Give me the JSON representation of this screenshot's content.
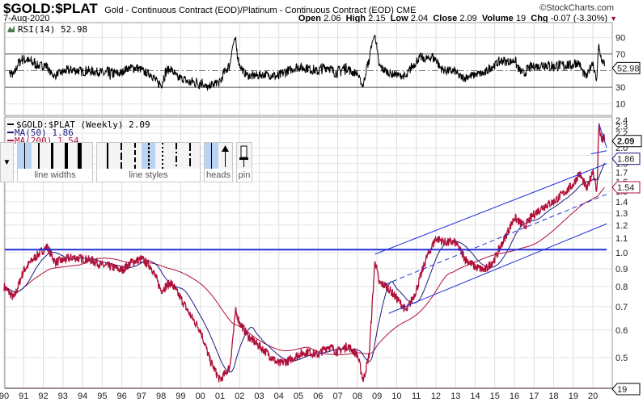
{
  "header": {
    "symbol": "$GOLD:$PLAT",
    "subtitle": "Gold - Continuous Contract (EOD)/Platinum - Continuous Contract (EOD)  CME",
    "logo": "©StockCharts.com",
    "date": "7-Aug-2020",
    "open_label": "Open",
    "open": "2.06",
    "high_label": "High",
    "high": "2.15",
    "low_label": "Low",
    "low": "2.04",
    "close_label": "Close",
    "close": "2.09",
    "volume_label": "Volume",
    "volume": "19",
    "chg_label": "Chg",
    "chg": "-0.07 (-3.30%)"
  },
  "toolbar": {
    "widths_label": "line widths",
    "styles_label": "line styles",
    "heads_label": "heads",
    "pin_label": "pin"
  },
  "colors": {
    "price": "#b0103a",
    "ma50": "#1a1a80",
    "ma200": "#b0103a",
    "trend": "#1f2fd8",
    "rsi": "#000000"
  },
  "chart_data": [
    {
      "type": "line",
      "title": "RSI(14) 52.98",
      "legend": "RSI(14) 52.98",
      "last_value_tag": "52.98",
      "yticks": [
        "90",
        "70",
        "30",
        "10"
      ],
      "ylim": [
        0,
        100
      ],
      "overbought": 70,
      "oversold": 30
    },
    {
      "type": "line",
      "scale": "log",
      "legend": [
        "$GOLD:$PLAT (Weekly) 2.09",
        "MA(50) 1.86",
        "MA(200) 1.54"
      ],
      "tags": {
        "price": "2.09",
        "ma50": "1.86",
        "ma200": "1.54",
        "volume": "19"
      },
      "ylim": [
        0.4,
        2.45
      ],
      "yticks": [
        "2.4",
        "2.3",
        "2.2",
        "2.0",
        "1.9",
        "1.8",
        "1.7",
        "1.6",
        "1.5",
        "1.4",
        "1.3",
        "1.2",
        "1.1",
        "1.0",
        "0.9",
        "0.8",
        "0.7",
        "0.6",
        "0.5"
      ],
      "xticks": [
        "90",
        "91",
        "92",
        "93",
        "94",
        "95",
        "96",
        "97",
        "98",
        "99",
        "00",
        "01",
        "02",
        "03",
        "04",
        "05",
        "06",
        "07",
        "08",
        "09",
        "10",
        "11",
        "12",
        "13",
        "14",
        "15",
        "16",
        "17",
        "18",
        "19",
        "20"
      ],
      "xlim": [
        1990,
        2020.7
      ],
      "series": {
        "name": "$GOLD:$PLAT",
        "x": [
          1990.0,
          1990.5,
          1991.0,
          1991.5,
          1992.0,
          1992.2,
          1992.6,
          1993.0,
          1993.5,
          1994.0,
          1994.5,
          1995.0,
          1995.5,
          1996.0,
          1996.5,
          1997.0,
          1997.5,
          1998.0,
          1998.5,
          1999.0,
          1999.5,
          2000.0,
          2000.5,
          2001.0,
          2001.5,
          2001.8,
          2002.0,
          2002.5,
          2003.0,
          2003.5,
          2004.0,
          2004.5,
          2005.0,
          2005.5,
          2006.0,
          2006.5,
          2007.0,
          2007.5,
          2008.0,
          2008.3,
          2008.6,
          2008.9,
          2009.1,
          2009.5,
          2010.0,
          2010.5,
          2011.0,
          2011.5,
          2012.0,
          2012.5,
          2013.0,
          2013.5,
          2014.0,
          2014.5,
          2015.0,
          2015.5,
          2016.0,
          2016.5,
          2017.0,
          2017.5,
          2018.0,
          2018.5,
          2019.0,
          2019.3,
          2019.7,
          2020.0,
          2020.2,
          2020.3,
          2020.45,
          2020.55,
          2020.6
        ],
        "values": [
          0.8,
          0.74,
          0.89,
          0.96,
          1.02,
          1.04,
          0.94,
          0.95,
          0.97,
          0.96,
          0.95,
          0.92,
          0.91,
          0.89,
          0.94,
          0.96,
          0.91,
          0.78,
          0.82,
          0.74,
          0.66,
          0.6,
          0.49,
          0.43,
          0.47,
          0.68,
          0.63,
          0.57,
          0.54,
          0.51,
          0.48,
          0.49,
          0.51,
          0.52,
          0.51,
          0.54,
          0.52,
          0.54,
          0.51,
          0.43,
          0.51,
          0.96,
          0.82,
          0.8,
          0.74,
          0.68,
          0.78,
          0.96,
          1.1,
          1.07,
          1.07,
          0.96,
          0.91,
          0.89,
          0.96,
          1.1,
          1.26,
          1.19,
          1.29,
          1.36,
          1.4,
          1.48,
          1.57,
          1.69,
          1.52,
          1.73,
          1.48,
          2.32,
          2.09,
          2.14,
          2.09
        ]
      },
      "trendlines": [
        {
          "style": "solid",
          "from": [
            1988.5,
            1.02
          ],
          "to": [
            2020.7,
            1.02
          ]
        },
        {
          "style": "solid",
          "from": [
            2008.9,
            0.99
          ],
          "to": [
            2020.7,
            1.8
          ]
        },
        {
          "style": "dashed",
          "from": [
            2009.4,
            0.81
          ],
          "to": [
            2020.7,
            1.47
          ]
        },
        {
          "style": "solid",
          "from": [
            2009.6,
            0.67
          ],
          "to": [
            2020.7,
            1.21
          ]
        },
        {
          "style": "solid",
          "from": [
            2020.3,
            2.35
          ],
          "to": [
            2020.7,
            2.0
          ]
        },
        {
          "style": "solid",
          "from": [
            2019.9,
            1.92
          ],
          "to": [
            2020.7,
            1.96
          ]
        }
      ]
    }
  ]
}
